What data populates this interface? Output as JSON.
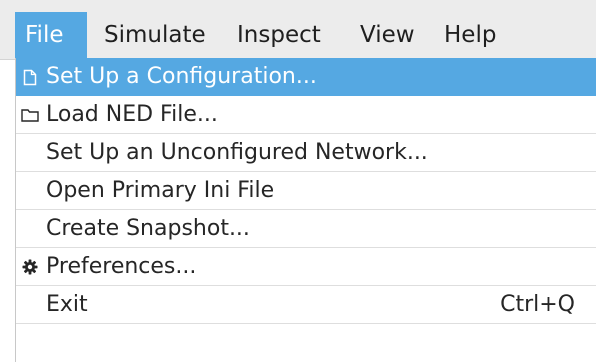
{
  "menubar": {
    "items": [
      {
        "label": "File"
      },
      {
        "label": "Simulate"
      },
      {
        "label": "Inspect"
      },
      {
        "label": "View"
      },
      {
        "label": "Help"
      }
    ]
  },
  "file_menu": {
    "items": [
      {
        "label": "Set Up a Configuration...",
        "icon": "document-icon"
      },
      {
        "label": "Load NED File...",
        "icon": "folder-icon"
      },
      {
        "label": "Set Up an Unconfigured Network..."
      },
      {
        "label": "Open Primary Ini File"
      },
      {
        "label": "Create Snapshot..."
      },
      {
        "label": "Preferences...",
        "icon": "gear-icon"
      },
      {
        "label": "Exit",
        "shortcut": "Ctrl+Q"
      }
    ]
  },
  "colors": {
    "highlight": "#55a8e2",
    "menubar_bg": "#ececec"
  }
}
